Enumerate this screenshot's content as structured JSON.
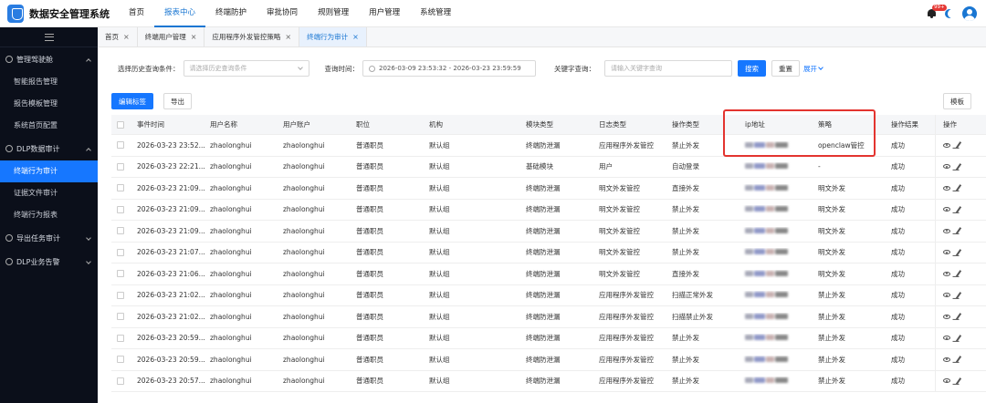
{
  "app": {
    "title": "数据安全管理系统",
    "notification_count": "99+"
  },
  "nav": [
    "首页",
    "报表中心",
    "终端防护",
    "审批协同",
    "规则管理",
    "用户管理",
    "系统管理"
  ],
  "sidebar": {
    "groups": [
      {
        "label": "管理驾驶舱",
        "items": [
          "智能报告管理",
          "报告模板管理",
          "系统首页配置"
        ]
      },
      {
        "label": "DLP数据审计",
        "items": [
          "终端行为审计",
          "证据文件审计",
          "终端行为报表"
        ]
      },
      {
        "label": "导出任务审计",
        "items": []
      },
      {
        "label": "DLP业务告警",
        "items": []
      }
    ]
  },
  "tabs": [
    "首页",
    "终端用户管理",
    "应用程序外发管控策略",
    "终端行为审计"
  ],
  "filters": {
    "history_label": "选择历史查询条件：",
    "history_placeholder": "请选择历史查询条件",
    "time_label": "查询时间：",
    "time_value": "2026-03-09 23:53:32 - 2026-03-23 23:59:59",
    "keyword_label": "关键字查询：",
    "keyword_placeholder": "请输入关键字查询",
    "search_btn": "搜索",
    "reset_btn": "重置",
    "expand_link": "展开"
  },
  "actions": {
    "edit_tags": "编辑标签",
    "export": "导出",
    "template": "模板"
  },
  "table": {
    "columns": [
      "事件时间",
      "用户名称",
      "用户账户",
      "职位",
      "机构",
      "模块类型",
      "日志类型",
      "操作类型",
      "ip地址",
      "策略",
      "操作结果",
      "操作"
    ],
    "rows": [
      [
        "2026-03-23 23:52...",
        "zhaolonghui",
        "zhaolonghui",
        "普通职员",
        "默认组",
        "终端防泄漏",
        "应用程序外发管控",
        "禁止外发",
        "openclaw管控",
        "成功"
      ],
      [
        "2026-03-23 22:21...",
        "zhaolonghui",
        "zhaolonghui",
        "普通职员",
        "默认组",
        "基础模块",
        "用户",
        "自动登录",
        "-",
        "成功"
      ],
      [
        "2026-03-23 21:09...",
        "zhaolonghui",
        "zhaolonghui",
        "普通职员",
        "默认组",
        "终端防泄漏",
        "明文外发管控",
        "直接外发",
        "明文外发",
        "成功"
      ],
      [
        "2026-03-23 21:09...",
        "zhaolonghui",
        "zhaolonghui",
        "普通职员",
        "默认组",
        "终端防泄漏",
        "明文外发管控",
        "禁止外发",
        "明文外发",
        "成功"
      ],
      [
        "2026-03-23 21:09...",
        "zhaolonghui",
        "zhaolonghui",
        "普通职员",
        "默认组",
        "终端防泄漏",
        "明文外发管控",
        "禁止外发",
        "明文外发",
        "成功"
      ],
      [
        "2026-03-23 21:07...",
        "zhaolonghui",
        "zhaolonghui",
        "普通职员",
        "默认组",
        "终端防泄漏",
        "明文外发管控",
        "禁止外发",
        "明文外发",
        "成功"
      ],
      [
        "2026-03-23 21:06...",
        "zhaolonghui",
        "zhaolonghui",
        "普通职员",
        "默认组",
        "终端防泄漏",
        "明文外发管控",
        "直接外发",
        "明文外发",
        "成功"
      ],
      [
        "2026-03-23 21:02...",
        "zhaolonghui",
        "zhaolonghui",
        "普通职员",
        "默认组",
        "终端防泄漏",
        "应用程序外发管控",
        "扫描正常外发",
        "禁止外发",
        "成功"
      ],
      [
        "2026-03-23 21:02...",
        "zhaolonghui",
        "zhaolonghui",
        "普通职员",
        "默认组",
        "终端防泄漏",
        "应用程序外发管控",
        "扫描禁止外发",
        "禁止外发",
        "成功"
      ],
      [
        "2026-03-23 20:59...",
        "zhaolonghui",
        "zhaolonghui",
        "普通职员",
        "默认组",
        "终端防泄漏",
        "应用程序外发管控",
        "禁止外发",
        "禁止外发",
        "成功"
      ],
      [
        "2026-03-23 20:59...",
        "zhaolonghui",
        "zhaolonghui",
        "普通职员",
        "默认组",
        "终端防泄漏",
        "应用程序外发管控",
        "禁止外发",
        "禁止外发",
        "成功"
      ],
      [
        "2026-03-23 20:57...",
        "zhaolonghui",
        "zhaolonghui",
        "普通职员",
        "默认组",
        "终端防泄漏",
        "应用程序外发管控",
        "禁止外发",
        "禁止外发",
        "成功"
      ]
    ]
  },
  "colors": {
    "accent": "#1677ff",
    "sidebar_bg": "#0b0f1a",
    "highlight": "#e3342f"
  }
}
